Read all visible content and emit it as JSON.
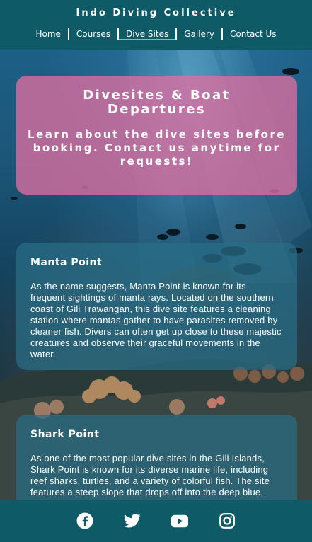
{
  "header": {
    "brand": "Indo Diving Collective",
    "nav": [
      {
        "label": "Home"
      },
      {
        "label": "Courses"
      },
      {
        "label": "Dive Sites"
      },
      {
        "label": "Gallery"
      },
      {
        "label": "Contact Us"
      }
    ],
    "active_nav": "Dive Sites"
  },
  "hero": {
    "title": "Divesites & Boat Departures",
    "subtitle": "Learn about the dive sites before booking. Contact us anytime for requests!"
  },
  "sites": [
    {
      "name": "Manta Point",
      "description": "As the name suggests, Manta Point is known for its frequent sightings of manta rays. Located on the southern coast of Gili Trawangan, this dive site features a cleaning station where mantas gather to have parasites removed by cleaner fish. Divers can often get up close to these majestic creatures and observe their graceful movements in the water."
    },
    {
      "name": "Shark Point",
      "description": "As one of the most popular dive sites in the Gili Islands, Shark Point is known for its diverse marine life, including reef sharks, turtles, and a variety of colorful fish. The site features a steep slope that drops off into the deep blue, making it an exciting"
    }
  ],
  "footer": {
    "social": [
      "facebook-icon",
      "twitter-icon",
      "youtube-icon",
      "instagram-icon"
    ]
  },
  "colors": {
    "header_bg": "#0e5a66",
    "hero_bg": "#de6ea0",
    "card_bg": "#286e87",
    "nav_underline": "#f08aa8"
  }
}
